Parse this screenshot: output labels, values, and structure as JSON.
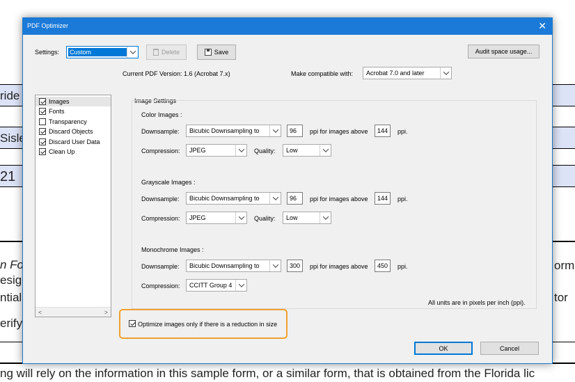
{
  "background_doc": {
    "fragments": [
      "ride",
      "Sisle",
      "21",
      "n For",
      "esigna",
      "ntial,",
      "erify",
      "orm v",
      "tor",
      "ng will rely on the information in this sample form, or a similar form, that is obtained from the Florida lic"
    ]
  },
  "dialog": {
    "title": "PDF Optimizer",
    "close_glyph": "✕",
    "settings_label": "Settings:",
    "settings_value": "Custom",
    "delete_label": "Delete",
    "save_label": "Save",
    "audit_label": "Audit space usage...",
    "current_version": "Current PDF Version: 1.6 (Acrobat 7.x)",
    "compat_label": "Make compatible with:",
    "compat_value": "Acrobat 7.0 and later",
    "panels": [
      {
        "label": "Images",
        "checked": true,
        "selected": true
      },
      {
        "label": "Fonts",
        "checked": true,
        "selected": false
      },
      {
        "label": "Transparency",
        "checked": false,
        "selected": false
      },
      {
        "label": "Discard Objects",
        "checked": true,
        "selected": false
      },
      {
        "label": "Discard User Data",
        "checked": true,
        "selected": false
      },
      {
        "label": "Clean Up",
        "checked": true,
        "selected": false
      }
    ],
    "image_settings_title": "Image Settings",
    "sections": [
      {
        "title": "Color Images :",
        "downsample_label": "Downsample:",
        "downsample_value": "Bicubic Downsampling to",
        "ppi_value": "96",
        "ppi_above_label": "ppi for images above",
        "above_value": "144",
        "ppi_label": "ppi.",
        "compression_label": "Compression:",
        "compression_value": "JPEG",
        "quality_label": "Quality:",
        "quality_value": "Low"
      },
      {
        "title": "Grayscale Images :",
        "downsample_label": "Downsample:",
        "downsample_value": "Bicubic Downsampling to",
        "ppi_value": "96",
        "ppi_above_label": "ppi for images above",
        "above_value": "144",
        "ppi_label": "ppi.",
        "compression_label": "Compression:",
        "compression_value": "JPEG",
        "quality_label": "Quality:",
        "quality_value": "Low"
      },
      {
        "title": "Monochrome Images :",
        "downsample_label": "Downsample:",
        "downsample_value": "Bicubic Downsampling to",
        "ppi_value": "300",
        "ppi_above_label": "ppi for images above",
        "above_value": "450",
        "ppi_label": "ppi.",
        "compression_label": "Compression:",
        "compression_value": "CCITT Group 4"
      }
    ],
    "units_note": "All units are in pixels per inch (ppi).",
    "optimize_only_label": "Optimize images only if there is a reduction in size",
    "optimize_only_checked": true,
    "highlight_color": "#f0a030",
    "ok_label": "OK",
    "cancel_label": "Cancel",
    "scroll_left": "<",
    "scroll_right": ">"
  }
}
